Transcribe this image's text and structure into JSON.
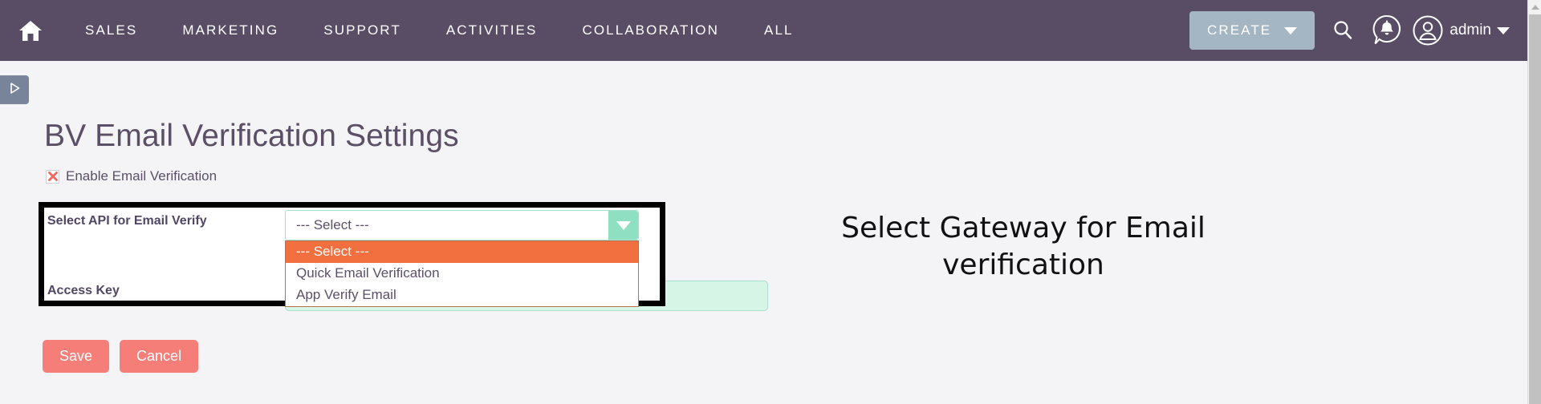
{
  "navbar": {
    "home_icon": "home-icon",
    "links": [
      {
        "label": "SALES"
      },
      {
        "label": "MARKETING"
      },
      {
        "label": "SUPPORT"
      },
      {
        "label": "ACTIVITIES"
      },
      {
        "label": "COLLABORATION"
      },
      {
        "label": "ALL"
      }
    ],
    "create_label": "CREATE",
    "search_icon": "search-icon",
    "notification_icon": "notification-bell-icon",
    "avatar_icon": "user-avatar-icon",
    "user_label": "admin",
    "background_color": "#584d64",
    "create_button_color": "#a4b5c4"
  },
  "sidebar_toggle": {
    "icon": "play-triangle-icon"
  },
  "page": {
    "title": "BV Email Verification Settings",
    "title_color": "#5b4f67"
  },
  "enable_verification": {
    "label": "Enable Email Verification",
    "checkbox_state": "x-marked",
    "checkbox_mark_color": "#f2675f"
  },
  "form": {
    "api_label": "Select API for Email Verify",
    "access_key_label": "Access Key",
    "access_key_value": "",
    "access_key_placeholder": "",
    "select": {
      "value": "--- Select ---",
      "arrow_icon": "chevron-down-icon",
      "arrow_button_color": "#8fe0c2",
      "highlight_color": "#f2703f",
      "options": [
        {
          "label": "--- Select ---",
          "selected": true
        },
        {
          "label": "Quick Email Verification",
          "selected": false
        },
        {
          "label": "App Verify Email",
          "selected": false
        }
      ]
    }
  },
  "actions": {
    "save_label": "Save",
    "cancel_label": "Cancel",
    "button_color": "#f57e78"
  },
  "annotation": {
    "text": "Select Gateway for Email verification"
  },
  "highlight": {
    "border_color": "#000000"
  },
  "scrollbar": {
    "up_arrow_icon": "scroll-up-arrow-icon"
  }
}
